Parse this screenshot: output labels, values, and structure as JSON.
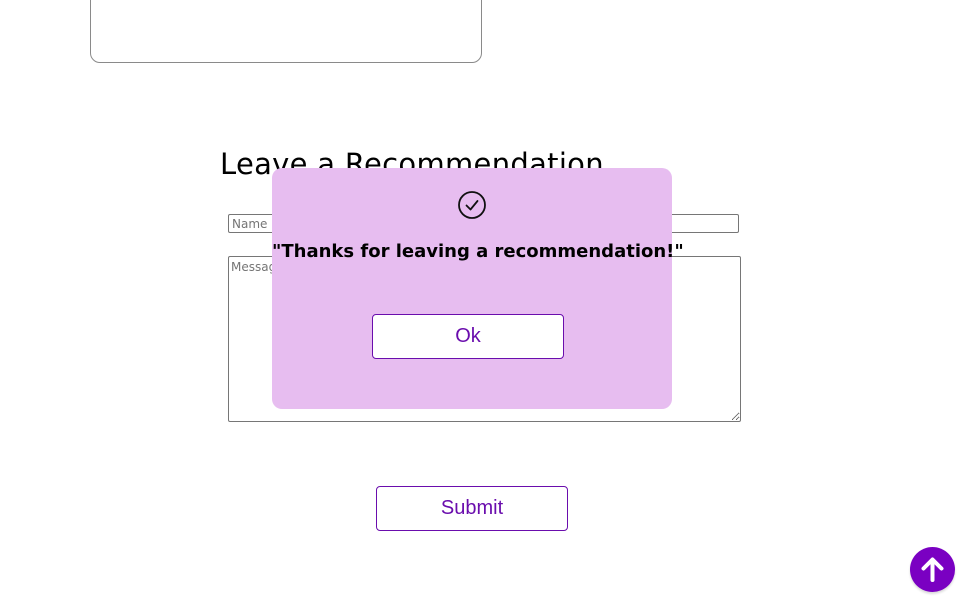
{
  "section": {
    "title": "Leave a Recommendation"
  },
  "form": {
    "name_placeholder": "Name (Optional)",
    "message_placeholder": "Message",
    "submit_label": "Submit"
  },
  "modal": {
    "icon": "check-circle-icon",
    "message": "\"Thanks for leaving a recommendation!\"",
    "ok_label": "Ok"
  },
  "scroll_top": {
    "icon": "arrow-up-icon"
  },
  "colors": {
    "accent": "#6a0dad",
    "modal_background": "#e7bdf0",
    "scroll_button": "#7a00c2"
  }
}
